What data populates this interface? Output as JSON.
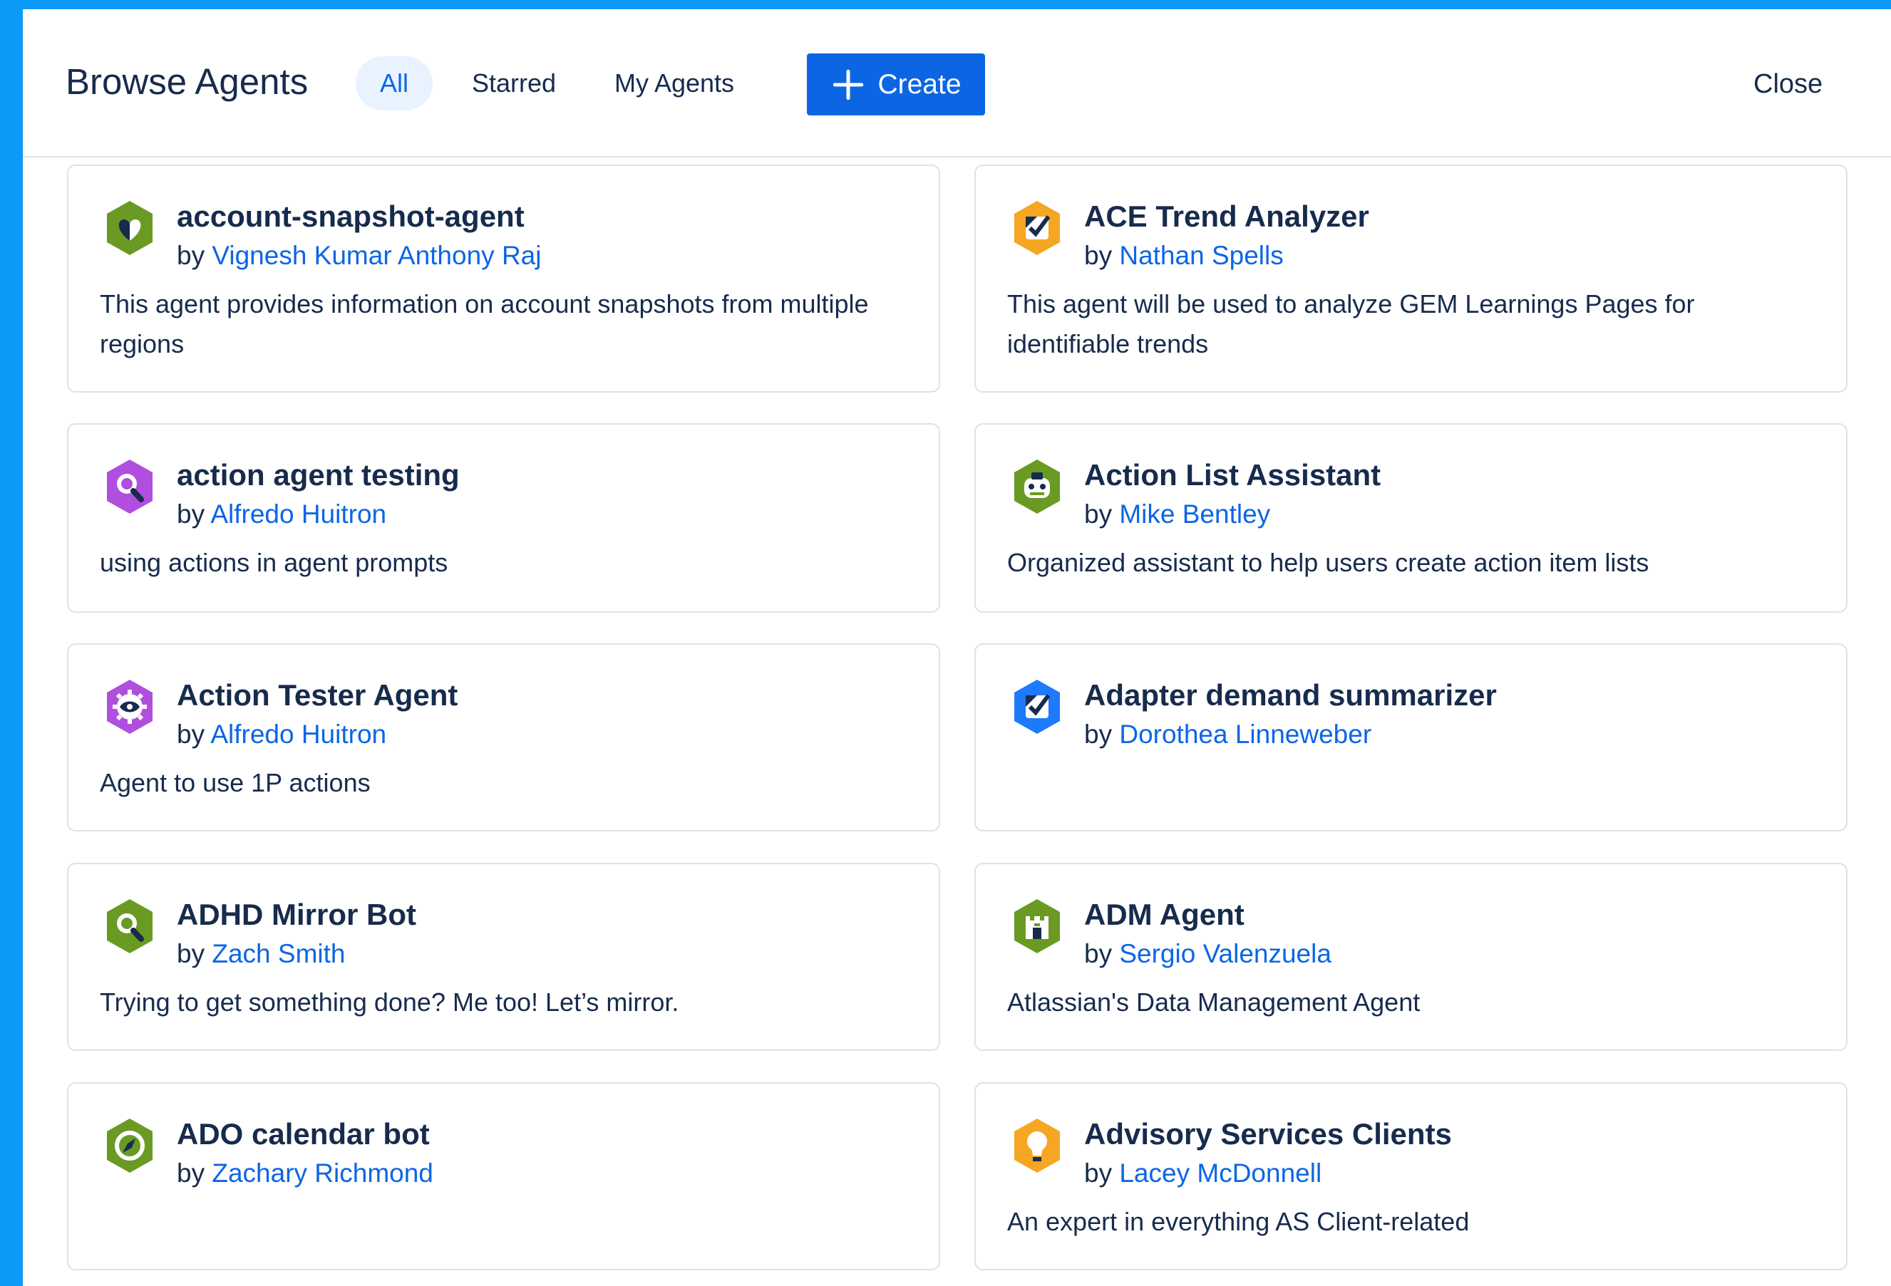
{
  "header": {
    "title": "Browse Agents",
    "tabs": [
      {
        "label": "All",
        "active": true
      },
      {
        "label": "Starred",
        "active": false
      },
      {
        "label": "My Agents",
        "active": false
      }
    ],
    "create_label": "Create",
    "close_label": "Close"
  },
  "colors": {
    "accent": "#0c66e4",
    "frame": "#0d99f7",
    "green": "#6a9a23",
    "orange": "#f5a623",
    "purple": "#b04ede",
    "blue": "#1d7afc"
  },
  "agents": [
    {
      "name": "account-snapshot-agent",
      "by": "by",
      "author": "Vignesh Kumar Anthony Raj",
      "description": "This agent provides information on account snapshots from multiple regions",
      "icon": "heart-icon",
      "color": "#6a9a23"
    },
    {
      "name": "ACE Trend Analyzer",
      "by": "by",
      "author": "Nathan Spells",
      "description": "This agent will be used to analyze GEM Learnings Pages for identifiable trends",
      "icon": "checkbox-icon",
      "color": "#f5a623"
    },
    {
      "name": "action agent testing",
      "by": "by",
      "author": "Alfredo Huitron",
      "description": "using actions in agent prompts",
      "icon": "magnifier-icon",
      "color": "#b04ede"
    },
    {
      "name": "Action List Assistant",
      "by": "by",
      "author": "Mike Bentley",
      "description": "Organized assistant to help users create action item lists",
      "icon": "robot-icon",
      "color": "#6a9a23"
    },
    {
      "name": "Action Tester Agent",
      "by": "by",
      "author": "Alfredo Huitron",
      "description": "Agent to use 1P actions",
      "icon": "gear-eye-icon",
      "color": "#b04ede"
    },
    {
      "name": "Adapter demand summarizer",
      "by": "by",
      "author": "Dorothea Linneweber",
      "description": "",
      "icon": "checkbox-icon",
      "color": "#1d7afc"
    },
    {
      "name": "ADHD Mirror Bot",
      "by": "by",
      "author": "Zach Smith",
      "description": "Trying to get something done? Me too! Let’s mirror.",
      "icon": "magnifier-icon",
      "color": "#6a9a23"
    },
    {
      "name": "ADM Agent",
      "by": "by",
      "author": "Sergio Valenzuela",
      "description": "Atlassian's Data Management Agent",
      "icon": "castle-icon",
      "color": "#6a9a23"
    },
    {
      "name": "ADO calendar bot",
      "by": "by",
      "author": "Zachary Richmond",
      "description": "",
      "icon": "compass-icon",
      "color": "#6a9a23"
    },
    {
      "name": "Advisory Services Clients",
      "by": "by",
      "author": "Lacey McDonnell",
      "description": "An expert in everything AS Client-related",
      "icon": "lightbulb-icon",
      "color": "#f5a623"
    }
  ]
}
